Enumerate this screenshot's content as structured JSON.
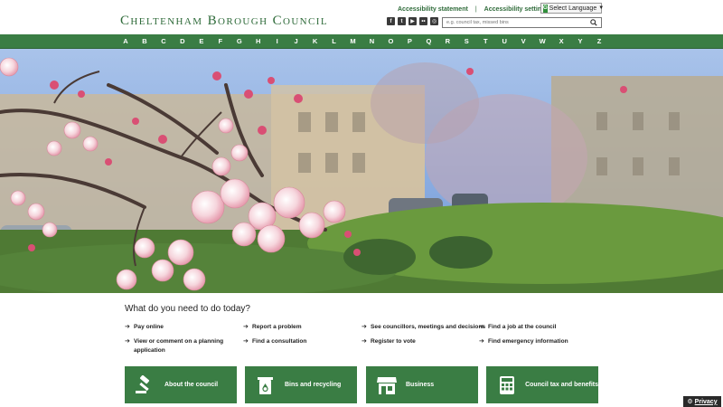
{
  "header": {
    "logo": "Cheltenham Borough Council",
    "accessibility_statement": "Accessibility statement",
    "separator": "|",
    "accessibility_settings": "Accessibility settings",
    "language_button": "Select Language",
    "search_placeholder": "e.g. council tax, missed bins",
    "social": [
      {
        "icon": "facebook-icon",
        "glyph": "f"
      },
      {
        "icon": "twitter-icon",
        "glyph": "t"
      },
      {
        "icon": "youtube-icon",
        "glyph": "▶"
      },
      {
        "icon": "flickr-icon",
        "glyph": "••"
      },
      {
        "icon": "instagram-icon",
        "glyph": "◎"
      }
    ]
  },
  "az_nav": [
    "A",
    "B",
    "C",
    "D",
    "E",
    "F",
    "G",
    "H",
    "I",
    "J",
    "K",
    "L",
    "M",
    "N",
    "O",
    "P",
    "Q",
    "R",
    "S",
    "T",
    "U",
    "V",
    "W",
    "X",
    "Y",
    "Z"
  ],
  "hero": {
    "image": "cherry-blossom-photo"
  },
  "tasks": {
    "title": "What do you need to do today?",
    "items": [
      {
        "label": "Pay online"
      },
      {
        "label": "Report a problem"
      },
      {
        "label": "See councillors, meetings and decisions"
      },
      {
        "label": "Find a job at the council"
      },
      {
        "label": "View or comment on a planning",
        "label2": "application"
      },
      {
        "label": "Find a consultation"
      },
      {
        "label": "Register to vote"
      },
      {
        "label": "Find emergency information"
      }
    ]
  },
  "cards": [
    {
      "label": "About the council",
      "icon": "gavel-icon"
    },
    {
      "label": "Bins and recycling",
      "icon": "recycle-bin-icon"
    },
    {
      "label": "Business",
      "icon": "shop-icon"
    },
    {
      "label": "Council tax and benefits",
      "icon": "calculator-icon"
    }
  ],
  "privacy": {
    "label": "Privacy"
  },
  "colors": {
    "brand_green": "#3a7d44",
    "logo_green": "#2f6b3a"
  }
}
